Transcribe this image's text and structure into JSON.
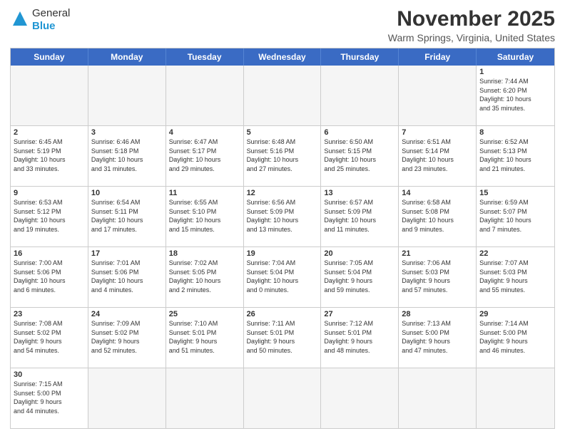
{
  "header": {
    "logo_line1": "General",
    "logo_line2": "Blue",
    "month_title": "November 2025",
    "location": "Warm Springs, Virginia, United States"
  },
  "day_headers": [
    "Sunday",
    "Monday",
    "Tuesday",
    "Wednesday",
    "Thursday",
    "Friday",
    "Saturday"
  ],
  "rows": [
    [
      {
        "day": "",
        "info": "",
        "empty": true
      },
      {
        "day": "",
        "info": "",
        "empty": true
      },
      {
        "day": "",
        "info": "",
        "empty": true
      },
      {
        "day": "",
        "info": "",
        "empty": true
      },
      {
        "day": "",
        "info": "",
        "empty": true
      },
      {
        "day": "",
        "info": "",
        "empty": true
      },
      {
        "day": "1",
        "info": "Sunrise: 7:44 AM\nSunset: 6:20 PM\nDaylight: 10 hours\nand 35 minutes.",
        "empty": false
      }
    ],
    [
      {
        "day": "2",
        "info": "Sunrise: 6:45 AM\nSunset: 5:19 PM\nDaylight: 10 hours\nand 33 minutes.",
        "empty": false
      },
      {
        "day": "3",
        "info": "Sunrise: 6:46 AM\nSunset: 5:18 PM\nDaylight: 10 hours\nand 31 minutes.",
        "empty": false
      },
      {
        "day": "4",
        "info": "Sunrise: 6:47 AM\nSunset: 5:17 PM\nDaylight: 10 hours\nand 29 minutes.",
        "empty": false
      },
      {
        "day": "5",
        "info": "Sunrise: 6:48 AM\nSunset: 5:16 PM\nDaylight: 10 hours\nand 27 minutes.",
        "empty": false
      },
      {
        "day": "6",
        "info": "Sunrise: 6:50 AM\nSunset: 5:15 PM\nDaylight: 10 hours\nand 25 minutes.",
        "empty": false
      },
      {
        "day": "7",
        "info": "Sunrise: 6:51 AM\nSunset: 5:14 PM\nDaylight: 10 hours\nand 23 minutes.",
        "empty": false
      },
      {
        "day": "8",
        "info": "Sunrise: 6:52 AM\nSunset: 5:13 PM\nDaylight: 10 hours\nand 21 minutes.",
        "empty": false
      }
    ],
    [
      {
        "day": "9",
        "info": "Sunrise: 6:53 AM\nSunset: 5:12 PM\nDaylight: 10 hours\nand 19 minutes.",
        "empty": false
      },
      {
        "day": "10",
        "info": "Sunrise: 6:54 AM\nSunset: 5:11 PM\nDaylight: 10 hours\nand 17 minutes.",
        "empty": false
      },
      {
        "day": "11",
        "info": "Sunrise: 6:55 AM\nSunset: 5:10 PM\nDaylight: 10 hours\nand 15 minutes.",
        "empty": false
      },
      {
        "day": "12",
        "info": "Sunrise: 6:56 AM\nSunset: 5:09 PM\nDaylight: 10 hours\nand 13 minutes.",
        "empty": false
      },
      {
        "day": "13",
        "info": "Sunrise: 6:57 AM\nSunset: 5:09 PM\nDaylight: 10 hours\nand 11 minutes.",
        "empty": false
      },
      {
        "day": "14",
        "info": "Sunrise: 6:58 AM\nSunset: 5:08 PM\nDaylight: 10 hours\nand 9 minutes.",
        "empty": false
      },
      {
        "day": "15",
        "info": "Sunrise: 6:59 AM\nSunset: 5:07 PM\nDaylight: 10 hours\nand 7 minutes.",
        "empty": false
      }
    ],
    [
      {
        "day": "16",
        "info": "Sunrise: 7:00 AM\nSunset: 5:06 PM\nDaylight: 10 hours\nand 6 minutes.",
        "empty": false
      },
      {
        "day": "17",
        "info": "Sunrise: 7:01 AM\nSunset: 5:06 PM\nDaylight: 10 hours\nand 4 minutes.",
        "empty": false
      },
      {
        "day": "18",
        "info": "Sunrise: 7:02 AM\nSunset: 5:05 PM\nDaylight: 10 hours\nand 2 minutes.",
        "empty": false
      },
      {
        "day": "19",
        "info": "Sunrise: 7:04 AM\nSunset: 5:04 PM\nDaylight: 10 hours\nand 0 minutes.",
        "empty": false
      },
      {
        "day": "20",
        "info": "Sunrise: 7:05 AM\nSunset: 5:04 PM\nDaylight: 9 hours\nand 59 minutes.",
        "empty": false
      },
      {
        "day": "21",
        "info": "Sunrise: 7:06 AM\nSunset: 5:03 PM\nDaylight: 9 hours\nand 57 minutes.",
        "empty": false
      },
      {
        "day": "22",
        "info": "Sunrise: 7:07 AM\nSunset: 5:03 PM\nDaylight: 9 hours\nand 55 minutes.",
        "empty": false
      }
    ],
    [
      {
        "day": "23",
        "info": "Sunrise: 7:08 AM\nSunset: 5:02 PM\nDaylight: 9 hours\nand 54 minutes.",
        "empty": false
      },
      {
        "day": "24",
        "info": "Sunrise: 7:09 AM\nSunset: 5:02 PM\nDaylight: 9 hours\nand 52 minutes.",
        "empty": false
      },
      {
        "day": "25",
        "info": "Sunrise: 7:10 AM\nSunset: 5:01 PM\nDaylight: 9 hours\nand 51 minutes.",
        "empty": false
      },
      {
        "day": "26",
        "info": "Sunrise: 7:11 AM\nSunset: 5:01 PM\nDaylight: 9 hours\nand 50 minutes.",
        "empty": false
      },
      {
        "day": "27",
        "info": "Sunrise: 7:12 AM\nSunset: 5:01 PM\nDaylight: 9 hours\nand 48 minutes.",
        "empty": false
      },
      {
        "day": "28",
        "info": "Sunrise: 7:13 AM\nSunset: 5:00 PM\nDaylight: 9 hours\nand 47 minutes.",
        "empty": false
      },
      {
        "day": "29",
        "info": "Sunrise: 7:14 AM\nSunset: 5:00 PM\nDaylight: 9 hours\nand 46 minutes.",
        "empty": false
      }
    ],
    [
      {
        "day": "30",
        "info": "Sunrise: 7:15 AM\nSunset: 5:00 PM\nDaylight: 9 hours\nand 44 minutes.",
        "empty": false
      },
      {
        "day": "",
        "info": "",
        "empty": true
      },
      {
        "day": "",
        "info": "",
        "empty": true
      },
      {
        "day": "",
        "info": "",
        "empty": true
      },
      {
        "day": "",
        "info": "",
        "empty": true
      },
      {
        "day": "",
        "info": "",
        "empty": true
      },
      {
        "day": "",
        "info": "",
        "empty": true
      }
    ]
  ]
}
